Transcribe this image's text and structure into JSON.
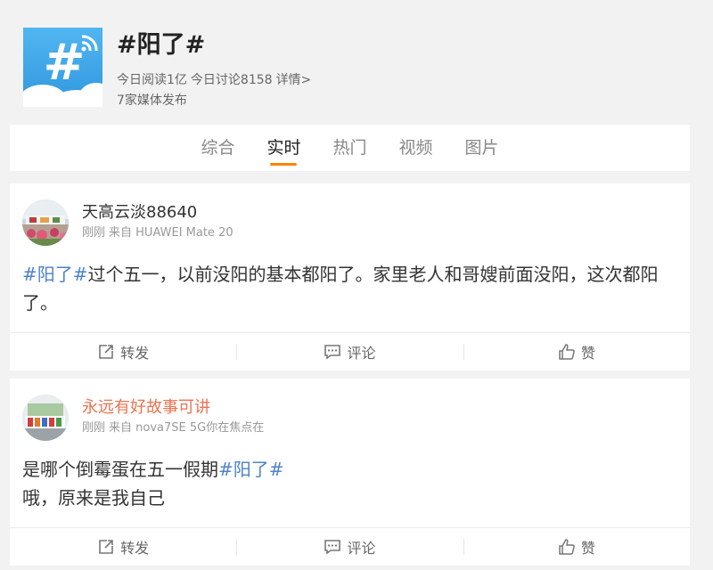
{
  "topic": {
    "title": "#阳了#",
    "reads": "今日阅读1亿",
    "discussions": "今日讨论8158",
    "details": "详情>",
    "media": "7家媒体发布"
  },
  "tabs": [
    {
      "label": "综合"
    },
    {
      "label": "实时",
      "active": true
    },
    {
      "label": "热门"
    },
    {
      "label": "视频"
    },
    {
      "label": "图片"
    }
  ],
  "posts": [
    {
      "author": "天高云淡88640",
      "time": "刚刚",
      "source": "来自 HUAWEI Mate 20",
      "topic_tag": "#阳了#",
      "text_after_tag": "过个五一，以前没阳的基本都阳了。家里老人和哥嫂前面没阳，这次都阳了。"
    },
    {
      "author": "永远有好故事可讲",
      "time": "刚刚",
      "source": "来自 nova7SE 5G你在焦点在",
      "text_before_tag": "是哪个倒霉蛋在五一假期",
      "topic_tag": "#阳了#",
      "text_second_line": "哦，原来是我自己"
    }
  ],
  "actions": {
    "repost": "转发",
    "comment": "评论",
    "like": "赞"
  },
  "colors": {
    "accent": "#ff8200",
    "link": "#4d82c9",
    "orange_name": "#eb7350"
  }
}
